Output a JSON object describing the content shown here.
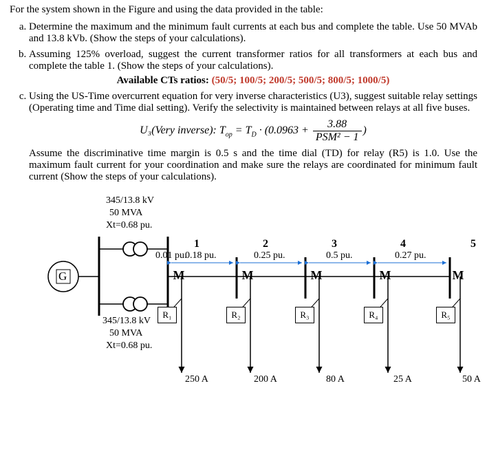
{
  "intro": "For the system shown in the Figure and using the data provided in the table:",
  "parts": {
    "a": "Determine the maximum and the minimum fault currents at each bus and complete the table. Use 50 MVAb and 13.8 kVb. (Show the steps of your calculations).",
    "b": "Assuming 125% overload, suggest the current transformer ratios for all transformers at each bus and complete the table 1. (Show the steps of your calculations).",
    "cts_label": "Available CTs ratios:",
    "cts_ratios": "(50/5; 100/5; 200/5; 500/5; 800/5; 1000/5)",
    "c": "Using the US-Time overcurrent equation for very inverse characteristics (U3), suggest suitable relay settings (Operating time and Time dial setting). Verify the selectivity is maintained between relays at all five buses."
  },
  "equation": {
    "lhs": "U₃(Very inverse): T",
    "lhs_sub": "op",
    "eq": " = T",
    "td_sub": "D",
    "mid": " · (0.0963 + ",
    "frac_num": "3.88",
    "frac_den": "PSM² − 1",
    "close": ")"
  },
  "assume": "Assume the discriminative time margin is 0.5 s and the time dial (TD) for relay (R5) is 1.0. Use the maximum fault current for your coordination and make sure the relays are coordinated for minimum fault current (Show the steps of your calculations).",
  "figure": {
    "tx1": {
      "kv": "345/13.8 kV",
      "mva": "50 MVA",
      "xt": "Xt=0.68 pu."
    },
    "tx2": {
      "kv": "345/13.8 kV",
      "mva": "50 MVA",
      "xt": "Xt=0.68 pu."
    },
    "xg": "0.01 pu.",
    "spans": {
      "s12": "0.18 pu.",
      "s23": "0.25 pu.",
      "s34": "0.5 pu.",
      "s45": "0.27 pu."
    },
    "buses": {
      "b1": "1",
      "b2": "2",
      "b3": "3",
      "b4": "4",
      "b5": "5"
    },
    "glyph": "M",
    "G": "G",
    "relays": {
      "r1": "R₁",
      "r2": "R₂",
      "r3": "R₃",
      "r4": "R₄",
      "r5": "R₅"
    },
    "loads": {
      "l1": "250 A",
      "l2": "200 A",
      "l3": "80 A",
      "l4": "25 A",
      "l5": "50 A"
    }
  }
}
